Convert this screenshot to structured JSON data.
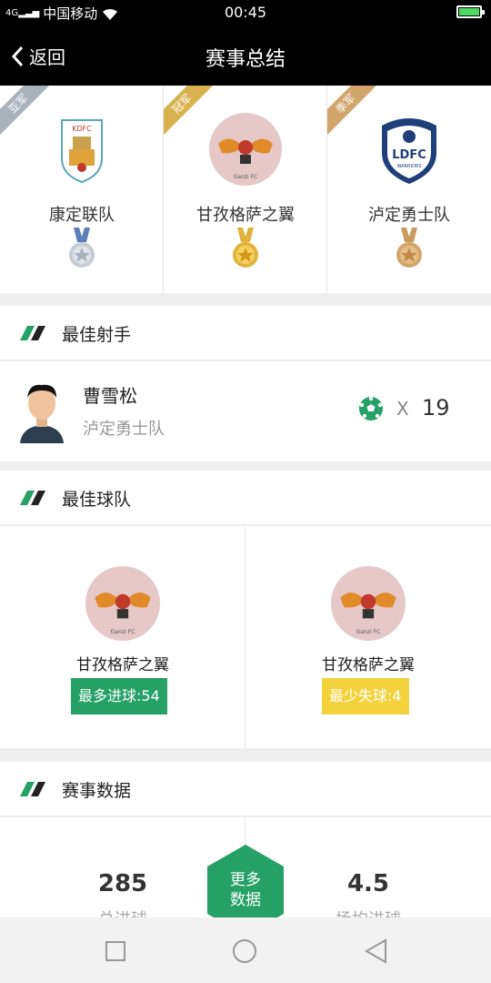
{
  "status_bar": {
    "network": "4G",
    "carrier": "中国移动",
    "time": "00:45"
  },
  "header": {
    "back_label": "返回",
    "title": "赛事总结"
  },
  "podium": [
    {
      "rank_label": "亚军",
      "team": "康定联队",
      "medal": "silver"
    },
    {
      "rank_label": "冠军",
      "team": "甘孜格萨之翼",
      "medal": "gold"
    },
    {
      "rank_label": "季军",
      "team": "泸定勇士队",
      "medal": "bronze"
    }
  ],
  "top_scorer": {
    "section_title": "最佳射手",
    "name": "曹雪松",
    "team": "泸定勇士队",
    "x": "X",
    "goals": "19"
  },
  "best_team": {
    "section_title": "最佳球队",
    "cards": [
      {
        "team": "甘孜格萨之翼",
        "badge": "最多进球:54",
        "badge_color": "#25a066"
      },
      {
        "team": "甘孜格萨之翼",
        "badge": "最少失球:4",
        "badge_color": "#f3d23b"
      }
    ]
  },
  "stats": {
    "section_title": "赛事数据",
    "total_goals": "285",
    "total_goals_label": "总进球",
    "avg_goals": "4.5",
    "avg_goals_label": "场均进球",
    "more_line1": "更多",
    "more_line2": "数据"
  },
  "logo_text": {
    "kangding": "KDFC",
    "ganzi": "Ganzi FC",
    "luding": "LDFC",
    "luding_sub": "WARRIORS"
  },
  "colors": {
    "accent_green": "#25a066",
    "accent_yellow": "#f3d23b",
    "gold": "#d7b24e",
    "silver": "#a8b2bb",
    "bronze": "#d1a56b"
  }
}
